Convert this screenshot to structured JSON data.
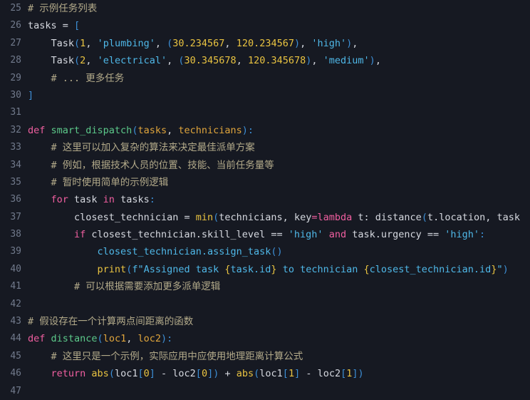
{
  "editor": {
    "name": "python-code-editor",
    "language": "Python",
    "first_line_number": 25,
    "last_line_number": 47,
    "background_color": "#161922",
    "gutter_color": "#717a8c",
    "colors": {
      "comment": "#b3aa8a",
      "keyword": "#f05fa0",
      "function": "#5cc98a",
      "builtin": "#e9c341",
      "number": "#e9c341",
      "string": "#4fb8e8",
      "variable": "#d6d9e0",
      "paren": "#3d8fd6",
      "param": "#e0a53c",
      "fstring_brace": "#e9c341"
    },
    "lines": [
      {
        "number": "25",
        "tokens": [
          {
            "text": "# 示例任务列表",
            "cls": "t-com"
          }
        ]
      },
      {
        "number": "26",
        "tokens": [
          {
            "text": "tasks ",
            "cls": "t-var"
          },
          {
            "text": "= ",
            "cls": "t-op"
          },
          {
            "text": "[",
            "cls": "t-par"
          }
        ]
      },
      {
        "number": "27",
        "tokens": [
          {
            "text": "    ",
            "cls": "t-plain"
          },
          {
            "text": "Task",
            "cls": "t-var"
          },
          {
            "text": "(",
            "cls": "t-par"
          },
          {
            "text": "1",
            "cls": "t-num"
          },
          {
            "text": ", ",
            "cls": "t-op"
          },
          {
            "text": "'plumbing'",
            "cls": "t-str"
          },
          {
            "text": ", ",
            "cls": "t-op"
          },
          {
            "text": "(",
            "cls": "t-par"
          },
          {
            "text": "30.234567",
            "cls": "t-num"
          },
          {
            "text": ", ",
            "cls": "t-op"
          },
          {
            "text": "120.234567",
            "cls": "t-num"
          },
          {
            "text": ")",
            "cls": "t-par"
          },
          {
            "text": ", ",
            "cls": "t-op"
          },
          {
            "text": "'high'",
            "cls": "t-str"
          },
          {
            "text": ")",
            "cls": "t-par"
          },
          {
            "text": ",",
            "cls": "t-op"
          }
        ]
      },
      {
        "number": "28",
        "tokens": [
          {
            "text": "    ",
            "cls": "t-plain"
          },
          {
            "text": "Task",
            "cls": "t-var"
          },
          {
            "text": "(",
            "cls": "t-par"
          },
          {
            "text": "2",
            "cls": "t-num"
          },
          {
            "text": ", ",
            "cls": "t-op"
          },
          {
            "text": "'electrical'",
            "cls": "t-str"
          },
          {
            "text": ", ",
            "cls": "t-op"
          },
          {
            "text": "(",
            "cls": "t-par"
          },
          {
            "text": "30.345678",
            "cls": "t-num"
          },
          {
            "text": ", ",
            "cls": "t-op"
          },
          {
            "text": "120.345678",
            "cls": "t-num"
          },
          {
            "text": ")",
            "cls": "t-par"
          },
          {
            "text": ", ",
            "cls": "t-op"
          },
          {
            "text": "'medium'",
            "cls": "t-str"
          },
          {
            "text": ")",
            "cls": "t-par"
          },
          {
            "text": ",",
            "cls": "t-op"
          }
        ]
      },
      {
        "number": "29",
        "tokens": [
          {
            "text": "    ",
            "cls": "t-plain"
          },
          {
            "text": "# ... 更多任务",
            "cls": "t-com"
          }
        ]
      },
      {
        "number": "30",
        "tokens": [
          {
            "text": "]",
            "cls": "t-par"
          }
        ]
      },
      {
        "number": "31",
        "tokens": []
      },
      {
        "number": "32",
        "tokens": [
          {
            "text": "def ",
            "cls": "t-kw"
          },
          {
            "text": "smart_dispatch",
            "cls": "t-fn"
          },
          {
            "text": "(",
            "cls": "t-par"
          },
          {
            "text": "tasks",
            "cls": "t-prm"
          },
          {
            "text": ", ",
            "cls": "t-op"
          },
          {
            "text": "technicians",
            "cls": "t-prm"
          },
          {
            "text": ")",
            "cls": "t-par"
          },
          {
            "text": ":",
            "cls": "t-par"
          }
        ]
      },
      {
        "number": "33",
        "tokens": [
          {
            "text": "    ",
            "cls": "t-plain"
          },
          {
            "text": "# 这里可以加入复杂的算法来决定最佳派单方案",
            "cls": "t-com"
          }
        ]
      },
      {
        "number": "34",
        "tokens": [
          {
            "text": "    ",
            "cls": "t-plain"
          },
          {
            "text": "# 例如，根据技术人员的位置、技能、当前任务量等",
            "cls": "t-com"
          }
        ]
      },
      {
        "number": "35",
        "tokens": [
          {
            "text": "    ",
            "cls": "t-plain"
          },
          {
            "text": "# 暂时使用简单的示例逻辑",
            "cls": "t-com"
          }
        ]
      },
      {
        "number": "36",
        "tokens": [
          {
            "text": "    ",
            "cls": "t-plain"
          },
          {
            "text": "for ",
            "cls": "t-kw"
          },
          {
            "text": "task ",
            "cls": "t-var"
          },
          {
            "text": "in ",
            "cls": "t-kw"
          },
          {
            "text": "tasks",
            "cls": "t-var"
          },
          {
            "text": ":",
            "cls": "t-par"
          }
        ]
      },
      {
        "number": "37",
        "tokens": [
          {
            "text": "        ",
            "cls": "t-plain"
          },
          {
            "text": "closest_technician ",
            "cls": "t-var"
          },
          {
            "text": "= ",
            "cls": "t-op"
          },
          {
            "text": "min",
            "cls": "t-bi"
          },
          {
            "text": "(",
            "cls": "t-par"
          },
          {
            "text": "technicians",
            "cls": "t-var"
          },
          {
            "text": ", ",
            "cls": "t-op"
          },
          {
            "text": "key",
            "cls": "t-var"
          },
          {
            "text": "=",
            "cls": "t-kw"
          },
          {
            "text": "lambda ",
            "cls": "t-kw"
          },
          {
            "text": "t",
            "cls": "t-var"
          },
          {
            "text": ": ",
            "cls": "t-op"
          },
          {
            "text": "distance",
            "cls": "t-var"
          },
          {
            "text": "(",
            "cls": "t-par"
          },
          {
            "text": "t.location",
            "cls": "t-var"
          },
          {
            "text": ", ",
            "cls": "t-op"
          },
          {
            "text": "task",
            "cls": "t-var"
          }
        ]
      },
      {
        "number": "38",
        "tokens": [
          {
            "text": "        ",
            "cls": "t-plain"
          },
          {
            "text": "if ",
            "cls": "t-kw"
          },
          {
            "text": "closest_technician.skill_level ",
            "cls": "t-var"
          },
          {
            "text": "== ",
            "cls": "t-op"
          },
          {
            "text": "'high' ",
            "cls": "t-str"
          },
          {
            "text": "and ",
            "cls": "t-kw"
          },
          {
            "text": "task.urgency ",
            "cls": "t-var"
          },
          {
            "text": "== ",
            "cls": "t-op"
          },
          {
            "text": "'high'",
            "cls": "t-str"
          },
          {
            "text": ":",
            "cls": "t-par"
          }
        ]
      },
      {
        "number": "39",
        "tokens": [
          {
            "text": "            ",
            "cls": "t-plain"
          },
          {
            "text": "closest_technician.assign_task",
            "cls": "t-str"
          },
          {
            "text": "()",
            "cls": "t-par"
          }
        ]
      },
      {
        "number": "40",
        "tokens": [
          {
            "text": "            ",
            "cls": "t-plain"
          },
          {
            "text": "print",
            "cls": "t-bi"
          },
          {
            "text": "(",
            "cls": "t-par"
          },
          {
            "text": "f\"Assigned task ",
            "cls": "t-fstr"
          },
          {
            "text": "{",
            "cls": "t-brace"
          },
          {
            "text": "task.id",
            "cls": "t-fstr"
          },
          {
            "text": "}",
            "cls": "t-brace"
          },
          {
            "text": " to technician ",
            "cls": "t-fstr"
          },
          {
            "text": "{",
            "cls": "t-brace"
          },
          {
            "text": "closest_technician.id",
            "cls": "t-fstr"
          },
          {
            "text": "}",
            "cls": "t-brace"
          },
          {
            "text": "\"",
            "cls": "t-fstr"
          },
          {
            "text": ")",
            "cls": "t-par"
          }
        ]
      },
      {
        "number": "41",
        "tokens": [
          {
            "text": "        ",
            "cls": "t-plain"
          },
          {
            "text": "# 可以根据需要添加更多派单逻辑",
            "cls": "t-com"
          }
        ]
      },
      {
        "number": "42",
        "tokens": []
      },
      {
        "number": "43",
        "tokens": [
          {
            "text": "# 假设存在一个计算两点间距离的函数",
            "cls": "t-com"
          }
        ]
      },
      {
        "number": "44",
        "tokens": [
          {
            "text": "def ",
            "cls": "t-kw"
          },
          {
            "text": "distance",
            "cls": "t-fn"
          },
          {
            "text": "(",
            "cls": "t-par"
          },
          {
            "text": "loc1",
            "cls": "t-prm"
          },
          {
            "text": ", ",
            "cls": "t-op"
          },
          {
            "text": "loc2",
            "cls": "t-prm"
          },
          {
            "text": ")",
            "cls": "t-par"
          },
          {
            "text": ":",
            "cls": "t-par"
          }
        ]
      },
      {
        "number": "45",
        "tokens": [
          {
            "text": "    ",
            "cls": "t-plain"
          },
          {
            "text": "# 这里只是一个示例，实际应用中应使用地理距离计算公式",
            "cls": "t-com"
          }
        ]
      },
      {
        "number": "46",
        "tokens": [
          {
            "text": "    ",
            "cls": "t-plain"
          },
          {
            "text": "return ",
            "cls": "t-kw"
          },
          {
            "text": "abs",
            "cls": "t-bi"
          },
          {
            "text": "(",
            "cls": "t-par"
          },
          {
            "text": "loc1",
            "cls": "t-var"
          },
          {
            "text": "[",
            "cls": "t-par"
          },
          {
            "text": "0",
            "cls": "t-num"
          },
          {
            "text": "]",
            "cls": "t-par"
          },
          {
            "text": " - ",
            "cls": "t-op"
          },
          {
            "text": "loc2",
            "cls": "t-var"
          },
          {
            "text": "[",
            "cls": "t-par"
          },
          {
            "text": "0",
            "cls": "t-num"
          },
          {
            "text": "]",
            "cls": "t-par"
          },
          {
            "text": ")",
            "cls": "t-par"
          },
          {
            "text": " + ",
            "cls": "t-op"
          },
          {
            "text": "abs",
            "cls": "t-bi"
          },
          {
            "text": "(",
            "cls": "t-par"
          },
          {
            "text": "loc1",
            "cls": "t-var"
          },
          {
            "text": "[",
            "cls": "t-par"
          },
          {
            "text": "1",
            "cls": "t-num"
          },
          {
            "text": "]",
            "cls": "t-par"
          },
          {
            "text": " - ",
            "cls": "t-op"
          },
          {
            "text": "loc2",
            "cls": "t-var"
          },
          {
            "text": "[",
            "cls": "t-par"
          },
          {
            "text": "1",
            "cls": "t-num"
          },
          {
            "text": "]",
            "cls": "t-par"
          },
          {
            "text": ")",
            "cls": "t-par"
          }
        ]
      },
      {
        "number": "47",
        "tokens": []
      }
    ]
  }
}
